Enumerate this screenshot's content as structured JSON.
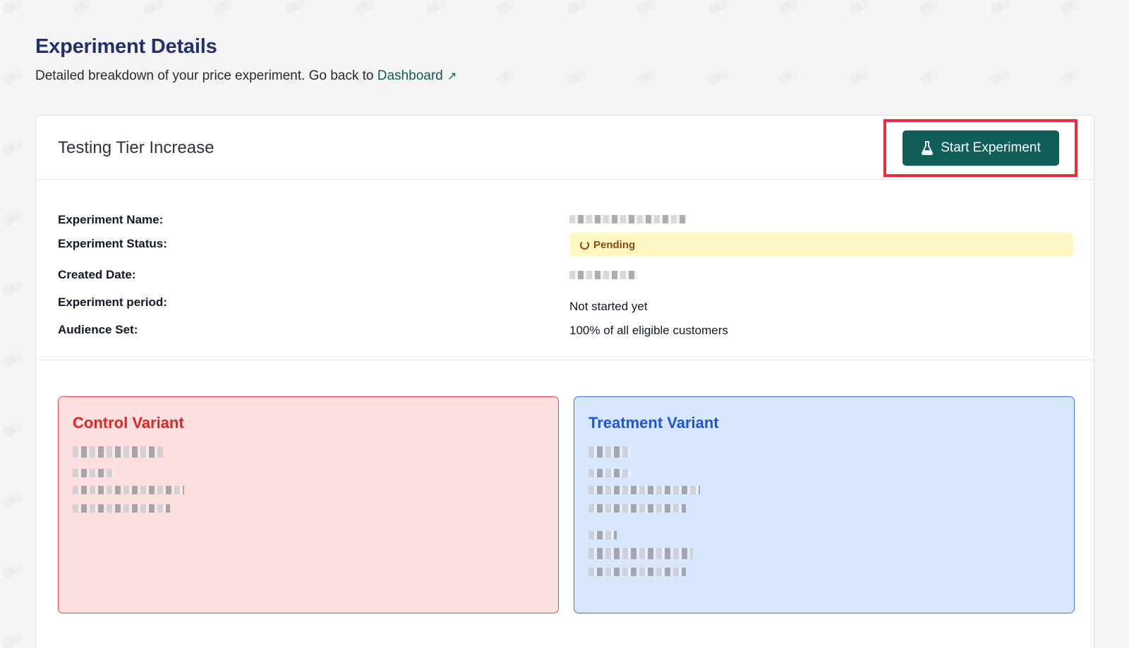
{
  "header": {
    "title": "Experiment Details",
    "subtitle": "Detailed breakdown of your price experiment. Go back to",
    "dashboard_link": "Dashboard",
    "link_icon": "external-arrow-icon"
  },
  "card": {
    "title": "Testing Tier Increase",
    "start_button": "Start Experiment",
    "start_icon": "flask-icon"
  },
  "details": {
    "name_label": "Experiment Name:",
    "status_label": "Experiment Status:",
    "status_value": "Pending",
    "created_label": "Created Date:",
    "period_label": "Experiment period:",
    "period_value": "Not started yet",
    "audience_label": "Audience Set:",
    "audience_value": "100% of all eligible customers"
  },
  "variants": {
    "control_title": "Control Variant",
    "treatment_title": "Treatment Variant"
  },
  "colors": {
    "brand": "#0f5e58",
    "title": "#25306b",
    "pending_bg": "#fef7c3",
    "control_bg": "#fddede",
    "treatment_bg": "#d6e6fd"
  }
}
